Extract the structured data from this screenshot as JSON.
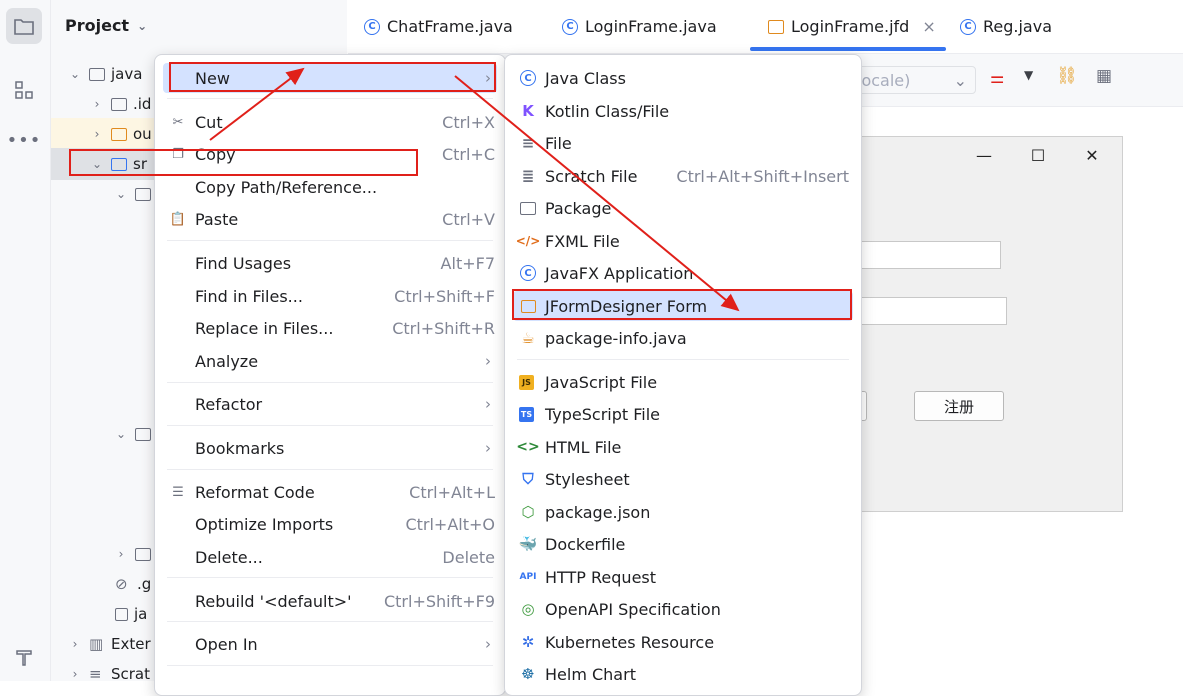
{
  "project_panel": {
    "title": "Project",
    "rows": [
      {
        "label": "java"
      },
      {
        "label": ".id"
      },
      {
        "label": "ou"
      },
      {
        "label": "sr"
      },
      {
        "label": ".g"
      },
      {
        "label": "ja"
      },
      {
        "label": "Exter"
      },
      {
        "label": "Scrat"
      }
    ]
  },
  "tabs": [
    {
      "label": "ChatFrame.java"
    },
    {
      "label": "LoginFrame.java"
    },
    {
      "label": "LoginFrame.jfd"
    },
    {
      "label": "Reg.java"
    }
  ],
  "toolbar": {
    "locale_placeholder": "locale)"
  },
  "form_preview": {
    "register_button": "注册"
  },
  "context_menu": {
    "items": [
      {
        "label": "New",
        "shortcut": ""
      },
      {
        "label": "Cut",
        "shortcut": "Ctrl+X"
      },
      {
        "label": "Copy",
        "shortcut": "Ctrl+C"
      },
      {
        "label": "Copy Path/Reference...",
        "shortcut": ""
      },
      {
        "label": "Paste",
        "shortcut": "Ctrl+V"
      },
      {
        "label": "Find Usages",
        "shortcut": "Alt+F7"
      },
      {
        "label": "Find in Files...",
        "shortcut": "Ctrl+Shift+F"
      },
      {
        "label": "Replace in Files...",
        "shortcut": "Ctrl+Shift+R"
      },
      {
        "label": "Analyze",
        "shortcut": ""
      },
      {
        "label": "Refactor",
        "shortcut": ""
      },
      {
        "label": "Bookmarks",
        "shortcut": ""
      },
      {
        "label": "Reformat Code",
        "shortcut": "Ctrl+Alt+L"
      },
      {
        "label": "Optimize Imports",
        "shortcut": "Ctrl+Alt+O"
      },
      {
        "label": "Delete...",
        "shortcut": "Delete"
      },
      {
        "label": "Rebuild '<default>'",
        "shortcut": "Ctrl+Shift+F9"
      },
      {
        "label": "Open In",
        "shortcut": ""
      }
    ]
  },
  "new_menu": {
    "items": [
      {
        "label": "Java Class",
        "shortcut": ""
      },
      {
        "label": "Kotlin Class/File",
        "shortcut": ""
      },
      {
        "label": "File",
        "shortcut": ""
      },
      {
        "label": "Scratch File",
        "shortcut": "Ctrl+Alt+Shift+Insert"
      },
      {
        "label": "Package",
        "shortcut": ""
      },
      {
        "label": "FXML File",
        "shortcut": ""
      },
      {
        "label": "JavaFX Application",
        "shortcut": ""
      },
      {
        "label": "JFormDesigner Form",
        "shortcut": ""
      },
      {
        "label": "package-info.java",
        "shortcut": ""
      },
      {
        "label": "JavaScript File",
        "shortcut": ""
      },
      {
        "label": "TypeScript File",
        "shortcut": ""
      },
      {
        "label": "HTML File",
        "shortcut": ""
      },
      {
        "label": "Stylesheet",
        "shortcut": ""
      },
      {
        "label": "package.json",
        "shortcut": ""
      },
      {
        "label": "Dockerfile",
        "shortcut": ""
      },
      {
        "label": "HTTP Request",
        "shortcut": ""
      },
      {
        "label": "OpenAPI Specification",
        "shortcut": ""
      },
      {
        "label": "Kubernetes Resource",
        "shortcut": ""
      },
      {
        "label": "Helm Chart",
        "shortcut": ""
      }
    ]
  },
  "icon_labels": {
    "js": "JS",
    "ts": "TS",
    "api": "API"
  },
  "colors": {
    "accent": "#3574f0",
    "annotation": "#e0201a",
    "selection": "#d4e2ff"
  }
}
